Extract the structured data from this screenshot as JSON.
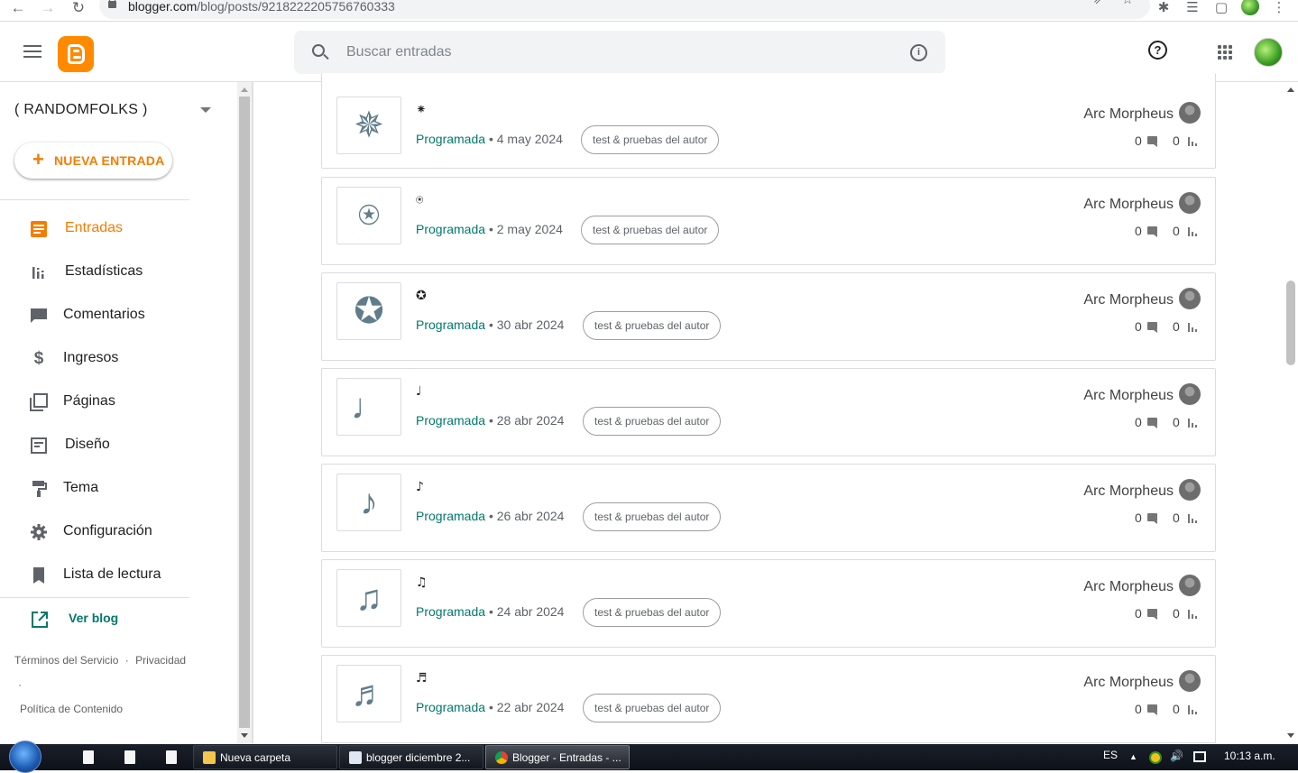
{
  "browser": {
    "url_host": "blogger.com",
    "url_path": "/blog/posts/9218222205756760333"
  },
  "header": {
    "search_placeholder": "Buscar entradas",
    "help_glyph": "?",
    "info_glyph": "i"
  },
  "sidebar": {
    "blog_name": "( RANDOMFOLKS )",
    "new_post_label": "NUEVA ENTRADA",
    "items": [
      {
        "label": "Entradas",
        "icon": "posts-icon",
        "active": true
      },
      {
        "label": "Estadísticas",
        "icon": "stats-icon"
      },
      {
        "label": "Comentarios",
        "icon": "comments-icon"
      },
      {
        "label": "Ingresos",
        "icon": "dollar-icon"
      },
      {
        "label": "Páginas",
        "icon": "pages-icon"
      },
      {
        "label": "Diseño",
        "icon": "layout-icon"
      },
      {
        "label": "Tema",
        "icon": "paint-roller-icon"
      },
      {
        "label": "Configuración",
        "icon": "gear-icon"
      },
      {
        "label": "Lista de lectura",
        "icon": "bookmark-icon"
      }
    ],
    "view_blog_label": "Ver blog",
    "footer": {
      "terms": "Términos del Servicio",
      "privacy": "Privacidad",
      "content_policy": "Política de Contenido",
      "dot": "·"
    }
  },
  "posts": [
    {
      "title": "⁕",
      "thumb_glyph": "✵",
      "status": "Programada",
      "date": "4 may 2024",
      "label": "test & pruebas del autor",
      "author": "Arc Morpheus",
      "comments": "0",
      "views": "0"
    },
    {
      "title": "⍟",
      "thumb_glyph": "⍟",
      "status": "Programada",
      "date": "2 may 2024",
      "label": "test & pruebas del autor",
      "author": "Arc Morpheus",
      "comments": "0",
      "views": "0"
    },
    {
      "title": "✪",
      "thumb_glyph": "✪",
      "status": "Programada",
      "date": "30 abr 2024",
      "label": "test & pruebas del autor",
      "author": "Arc Morpheus",
      "comments": "0",
      "views": "0"
    },
    {
      "title": "♩",
      "thumb_glyph": "♩",
      "status": "Programada",
      "date": "28 abr 2024",
      "label": "test & pruebas del autor",
      "author": "Arc Morpheus",
      "comments": "0",
      "views": "0"
    },
    {
      "title": "♪",
      "thumb_glyph": "♪",
      "status": "Programada",
      "date": "26 abr 2024",
      "label": "test & pruebas del autor",
      "author": "Arc Morpheus",
      "comments": "0",
      "views": "0"
    },
    {
      "title": "♫",
      "thumb_glyph": "♫",
      "status": "Programada",
      "date": "24 abr 2024",
      "label": "test & pruebas del autor",
      "author": "Arc Morpheus",
      "comments": "0",
      "views": "0"
    },
    {
      "title": "♬",
      "thumb_glyph": "♬",
      "status": "Programada",
      "date": "22 abr 2024",
      "label": "test & pruebas del autor",
      "author": "Arc Morpheus",
      "comments": "0",
      "views": "0"
    }
  ],
  "meta_separator": "•",
  "taskbar": {
    "tasks": [
      {
        "label": "Nueva carpeta",
        "icon": "folder-icon"
      },
      {
        "label": "blogger diciembre 2...",
        "icon": "notepad-icon"
      },
      {
        "label": "Blogger - Entradas - ...",
        "icon": "chrome-icon",
        "active": true
      }
    ],
    "language": "ES",
    "clock": "10:13 a.m."
  },
  "colors": {
    "accent": "#f57c00",
    "status": "#00796b",
    "logo": "#ff8a00"
  }
}
